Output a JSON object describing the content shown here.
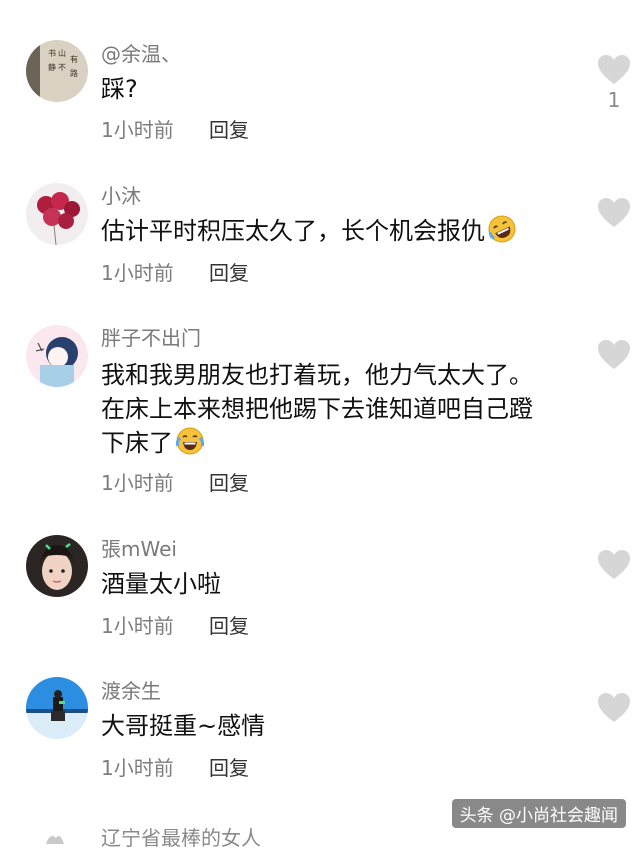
{
  "comments": [
    {
      "username": "@余温、",
      "text": "踩?",
      "time": "1小时前",
      "reply": "回复",
      "likes": "1"
    },
    {
      "username": "小沐",
      "text": "估计平时积压太久了，长个机会报仇",
      "time": "1小时前",
      "reply": "回复",
      "emoji": "rolling-laugh-emoji"
    },
    {
      "username": "胖子不出门",
      "lines": [
        "我和我男朋友也打着玩，他力气太大了。",
        "在床上本来想把他踢下去谁知道吧自己蹬",
        "下床了"
      ],
      "time": "1小时前",
      "reply": "回复",
      "emoji": "tears-of-joy-emoji"
    },
    {
      "username": "張mWei",
      "text": "酒量太小啦",
      "time": "1小时前",
      "reply": "回复"
    },
    {
      "username": "渡余生",
      "text": "大哥挺重~感情",
      "time": "1小时前",
      "reply": "回复"
    }
  ],
  "partial_username": "辽宁省最棒的女人",
  "watermark": "头条 @小尚社会趣闻",
  "colors": {
    "username": "#7a7a7a",
    "text": "#111111",
    "heart": "#d6d6d6"
  }
}
